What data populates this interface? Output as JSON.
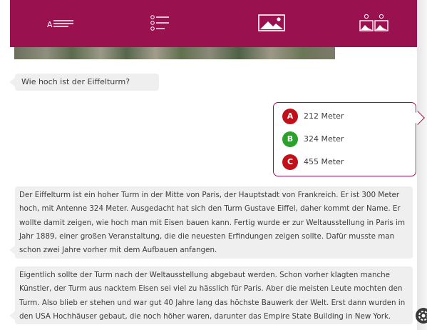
{
  "header": {
    "tabs": [
      {
        "name": "text-tab",
        "icon": "text-lines-icon",
        "label": "A"
      },
      {
        "name": "quiz-tab",
        "icon": "list-options-icon"
      },
      {
        "name": "image-tab",
        "icon": "landscape-image-icon"
      },
      {
        "name": "image-pair-tab",
        "icon": "image-pair-icon"
      }
    ],
    "color": "#9a1150"
  },
  "chat": {
    "question": "Wie hoch ist der Eiffelturm?",
    "answers": [
      {
        "letter": "A",
        "text": "212 Meter",
        "color": "#c0101a"
      },
      {
        "letter": "B",
        "text": "324 Meter",
        "color": "#2aa12a"
      },
      {
        "letter": "C",
        "text": "455 Meter",
        "color": "#c0101a"
      }
    ],
    "paragraph1": "Der Eiffelturm ist ein hoher Turm in der Mitte von Paris, der Hauptstadt von Frankreich. Er ist 300 Meter hoch, mit Antenne 324 Meter. Ausgedacht hat sich den Turm Gustave Eiffel, daher kommt der Name. Er wollte damit zeigen, wie hoch man mit Eisen bauen kann. Fertig wurde er zur Weltausstellung in Paris im Jahr 1889, einer großen Veranstaltung, die die neuesten Erfindungen zeigen sollte. Dafür musste man schon zwei Jahre vorher mit dem Aufbauen anfangen.",
    "paragraph2": "Eigentlich sollte der Turm nach der Weltausstellung abgebaut werden. Schon vorher klagten manche Künstler, der Turm aus nacktem Eisen sei viel zu hässlich für Paris. Aber die meisten Leute mochten den Turm. Also blieb er stehen und war gut 40 Jahre lang das höchste Bauwerk der Welt. Erst dann wurden in den USA Hochhäuser gebaut, die noch höher waren, darunter das Empire State Building in New York."
  },
  "settings_icon": "gear-icon"
}
